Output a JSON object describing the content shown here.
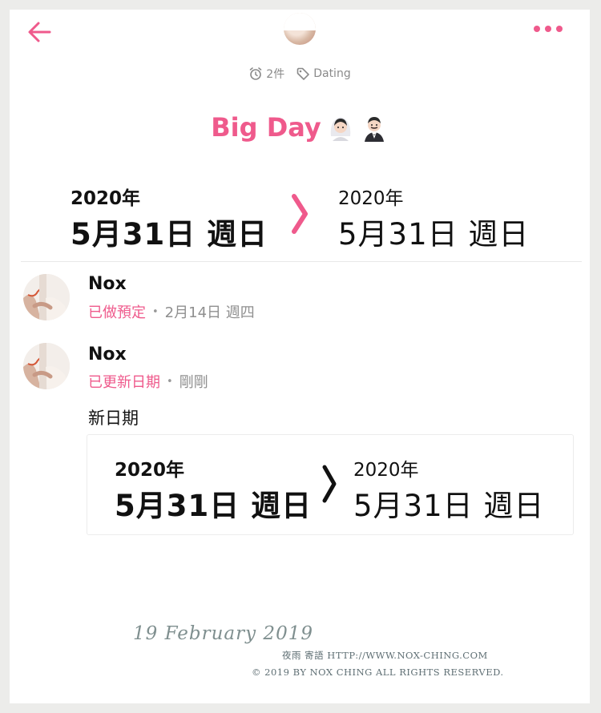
{
  "header": {
    "meta": [
      {
        "icon": "alarm-clock-icon",
        "label": "2件"
      },
      {
        "icon": "tag-icon",
        "label": "Dating"
      }
    ],
    "title": "Big Day",
    "colors": {
      "accent": "#ef5a8c"
    }
  },
  "main_range": {
    "from": {
      "year": "2020年",
      "day": "5月31日 週日"
    },
    "to": {
      "year": "2020年",
      "day": "5月31日 週日"
    }
  },
  "activity": [
    {
      "name": "Nox",
      "status": "已做預定",
      "separator": "•",
      "time": "2月14日 週四"
    },
    {
      "name": "Nox",
      "status": "已更新日期",
      "separator": "•",
      "time": "剛剛",
      "detail_label": "新日期",
      "range": {
        "from": {
          "year": "2020年",
          "day": "5月31日 週日"
        },
        "to": {
          "year": "2020年",
          "day": "5月31日 週日"
        }
      }
    }
  ],
  "watermark": {
    "date": "19 February 2019",
    "url": "夜雨 寄語 HTTP://WWW.NOX-CHING.COM",
    "rights": "© 2019 BY NOX CHING ALL RIGHTS RESERVED."
  }
}
